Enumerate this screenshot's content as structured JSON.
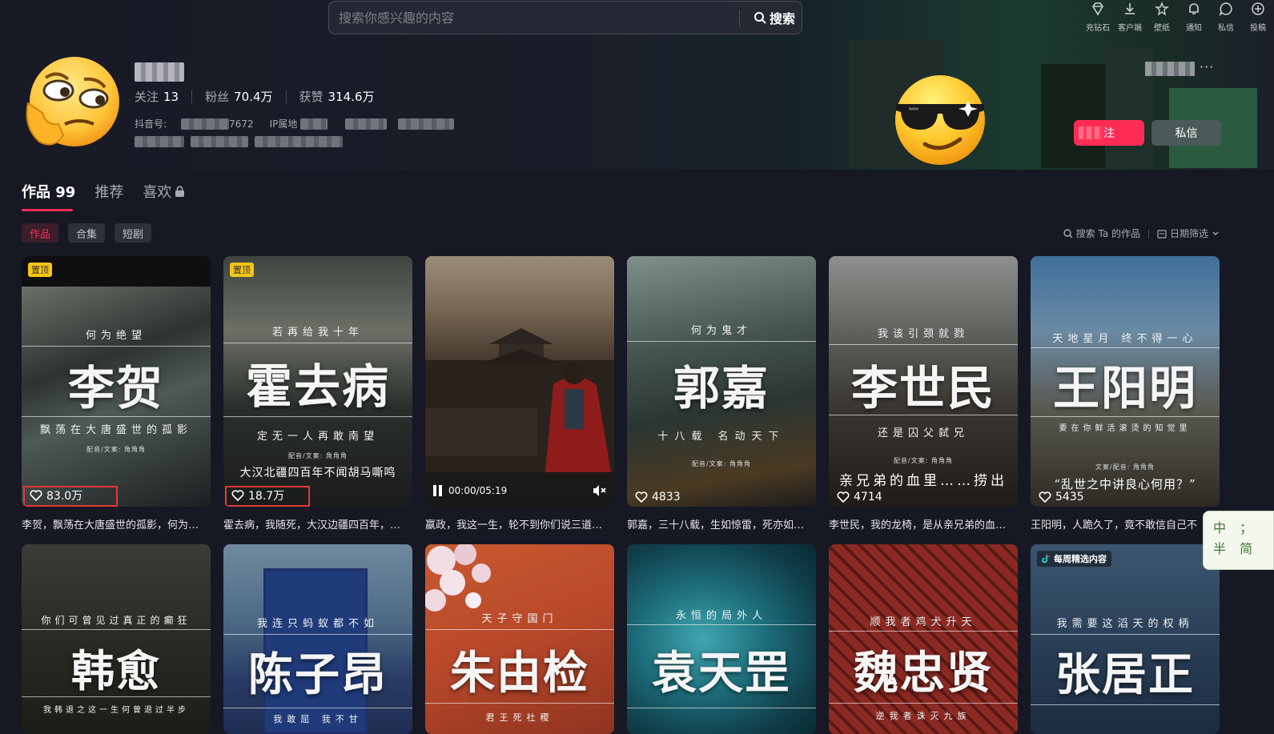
{
  "search": {
    "placeholder": "搜索你感兴趣的内容",
    "button_label": "搜索"
  },
  "topnav": [
    {
      "label": "充钻石",
      "icon": "diamond-icon"
    },
    {
      "label": "客户端",
      "icon": "download-icon"
    },
    {
      "label": "壁纸",
      "icon": "wallpaper-icon"
    },
    {
      "label": "通知",
      "icon": "bell-icon"
    },
    {
      "label": "私信",
      "icon": "message-icon"
    },
    {
      "label": "投稿",
      "icon": "plus-circle-icon"
    }
  ],
  "profile": {
    "following_label": "关注",
    "following": "13",
    "followers_label": "粉丝",
    "followers": "70.4万",
    "likes_label": "获赞",
    "likes": "314.6万",
    "douyin_id_label": "抖音号:",
    "douyin_id_tail": "7672",
    "ip_label": "IP属地",
    "follow_button": "注",
    "message_button": "私信",
    "more": "···"
  },
  "tabs": [
    {
      "label": "作品 99",
      "active": true
    },
    {
      "label": "推荐",
      "active": false
    },
    {
      "label": "喜欢",
      "active": false,
      "locked": true
    }
  ],
  "chips": [
    {
      "label": "作品",
      "active": true
    },
    {
      "label": "合集",
      "active": false
    },
    {
      "label": "短剧",
      "active": false
    }
  ],
  "tools": {
    "search_label": "搜索 Ta 的作品",
    "date_filter_label": "日期筛选"
  },
  "videos": [
    {
      "pin": "置顶",
      "top_line": "何为绝望",
      "name": "李贺",
      "sub": "飘荡在大唐盛世的孤影",
      "credit": "配音/文案: 角角角",
      "bottom": "",
      "likes": "83.0万",
      "caption": "李贺，飘荡在大唐盛世的孤影，何为…"
    },
    {
      "pin": "置顶",
      "top_line": "若再给我十年",
      "name": "霍去病",
      "sub": "定无一人再敢南望",
      "credit": "配音/文案: 角角角",
      "bottom": "大汉北疆四百年不闻胡马嘶鸣",
      "likes": "18.7万",
      "caption": "霍去病，我随死，大汉边疆四百年，…"
    },
    {
      "player_time": "00:00/05:19",
      "caption": "嬴政，我这一生，轮不到你们说三道…"
    },
    {
      "top_line": "何为鬼才",
      "name": "郭嘉",
      "sub": "十八载 名动天下",
      "credit": "配音/文案: 角角角",
      "bottom": "",
      "likes": "4833",
      "caption": "郭嘉，三十八载，生如惊雷，死亦如…"
    },
    {
      "top_line": "我该引颈就戮",
      "name": "李世民",
      "sub": "还是囚父弑兄",
      "credit": "配音/文案: 角角角",
      "bottom": "亲兄弟的血里……捞出",
      "likes": "4714",
      "caption": "李世民，我的龙椅，是从亲兄弟的血…"
    },
    {
      "top_line": "天地星月 终不得一心",
      "name": "王阳明",
      "sub": "要在你鲜活滚烫的知觉里",
      "credit": "文案/配音: 角角角",
      "bottom": "“乱世之中讲良心何用？”",
      "likes": "5435",
      "caption": "王阳明，人跪久了，竟不敢信自己不"
    },
    {
      "top_line": "你们可曾见过真正的癫狂",
      "name": "韩愈",
      "sub": "我韩退之这一生何曾退过半步",
      "caption": ""
    },
    {
      "top_line": "我连只蚂蚁都不如",
      "name": "陈子昂",
      "sub": "我敢屈 我不甘",
      "caption": ""
    },
    {
      "top_line": "天子守国门",
      "name": "朱由检",
      "sub": "君王死社稷",
      "caption": ""
    },
    {
      "top_line": "永恒的局外人",
      "name": "袁天罡",
      "sub": "",
      "caption": ""
    },
    {
      "top_line": "顺我者鸡犬升天",
      "name": "魏忠贤",
      "sub": "逆我者诛灭九族",
      "caption": ""
    },
    {
      "weekly": "每周精选内容",
      "top_line": "我需要这滔天的权柄",
      "name": "张居正",
      "sub": "",
      "caption": ""
    }
  ],
  "ime": {
    "line1": "中 ；",
    "line2": "半 简"
  }
}
